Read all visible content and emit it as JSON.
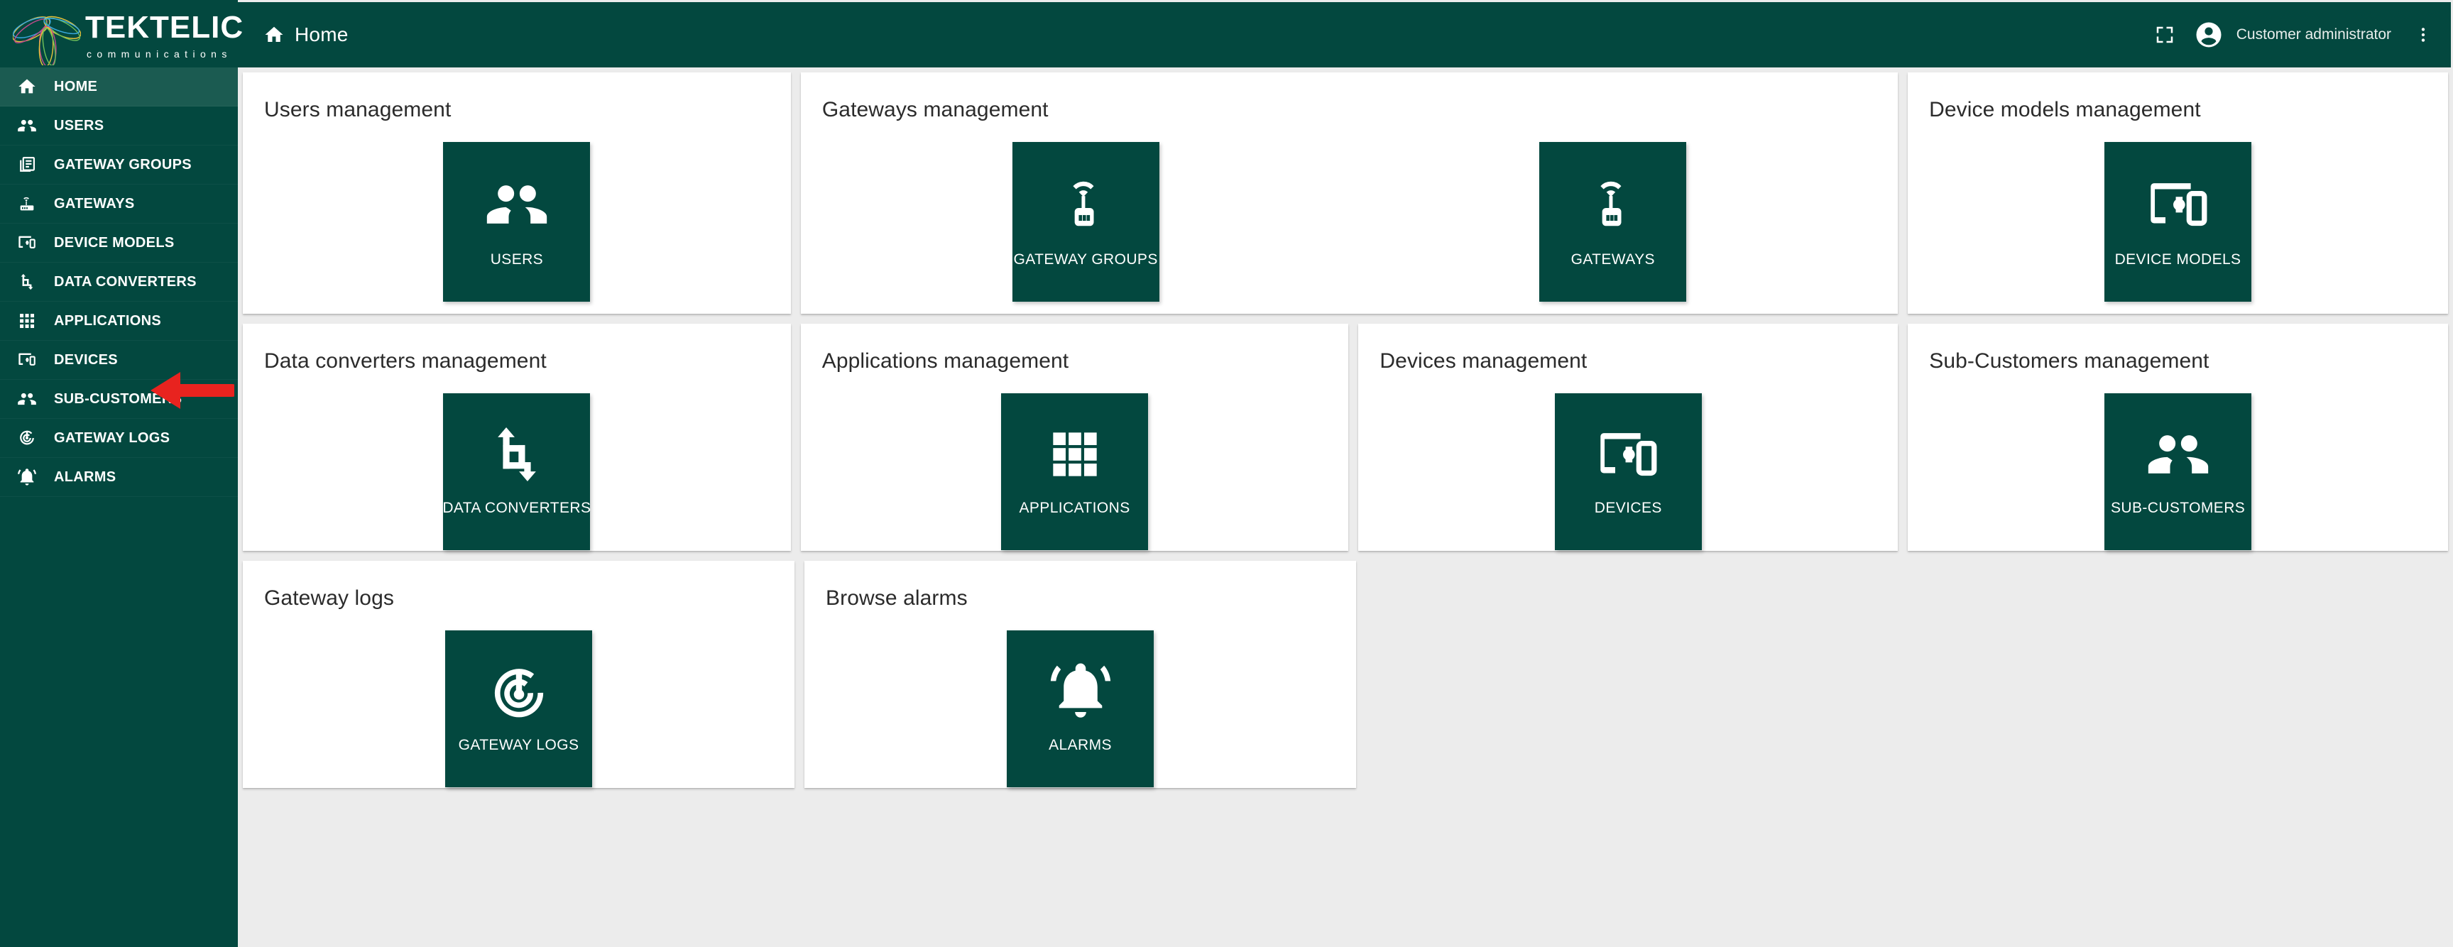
{
  "brand": {
    "name": "TEKTELIC",
    "tagline": "communications",
    "logo_icon": "tektelic-trefoil-logo",
    "primary_color": "#03483f",
    "active_nav_color": "#1b5b51",
    "page_background": "#ececec",
    "annotation_arrow_color": "#e8231f"
  },
  "topbar": {
    "home_icon": "home-icon",
    "title": "Home",
    "fullscreen_icon": "fullscreen-icon",
    "avatar_icon": "account-circle-icon",
    "account_name": "Customer administrator",
    "kebab_icon": "more-vert-icon"
  },
  "sidebar": {
    "items": [
      {
        "label": "HOME",
        "icon": "home-icon",
        "active": true
      },
      {
        "label": "USERS",
        "icon": "people-icon",
        "active": false
      },
      {
        "label": "GATEWAY GROUPS",
        "icon": "library-books-icon",
        "active": false
      },
      {
        "label": "GATEWAYS",
        "icon": "router-icon",
        "active": false
      },
      {
        "label": "DEVICE MODELS",
        "icon": "devices-other-icon",
        "active": false
      },
      {
        "label": "DATA CONVERTERS",
        "icon": "transform-icon",
        "active": false
      },
      {
        "label": "APPLICATIONS",
        "icon": "apps-grid-icon",
        "active": false
      },
      {
        "label": "DEVICES",
        "icon": "devices-other-icon",
        "active": false
      },
      {
        "label": "SUB-CUSTOMERS",
        "icon": "people-icon",
        "active": false
      },
      {
        "label": "GATEWAY LOGS",
        "icon": "track-changes-icon",
        "active": false
      },
      {
        "label": "ALARMS",
        "icon": "notifications-icon",
        "active": false
      }
    ]
  },
  "annotation": {
    "type": "red-left-arrow",
    "points_to": "APPLICATIONS"
  },
  "dashboard": {
    "rows": [
      {
        "cards": [
          {
            "title": "Users management",
            "tiles": [
              {
                "label": "USERS",
                "icon": "people-icon"
              }
            ]
          },
          {
            "title": "Gateways management",
            "tiles": [
              {
                "label": "GATEWAY GROUPS",
                "icon": "router-icon"
              },
              {
                "label": "GATEWAYS",
                "icon": "router-icon"
              }
            ]
          },
          {
            "title": "Device models management",
            "tiles": [
              {
                "label": "DEVICE MODELS",
                "icon": "devices-other-icon"
              }
            ]
          }
        ]
      },
      {
        "cards": [
          {
            "title": "Data converters management",
            "tiles": [
              {
                "label": "DATA CONVERTERS",
                "icon": "transform-icon"
              }
            ]
          },
          {
            "title": "Applications management",
            "tiles": [
              {
                "label": "APPLICATIONS",
                "icon": "apps-grid-icon"
              }
            ]
          },
          {
            "title": "Devices management",
            "tiles": [
              {
                "label": "DEVICES",
                "icon": "devices-other-icon"
              }
            ]
          },
          {
            "title": "Sub-Customers management",
            "tiles": [
              {
                "label": "SUB-CUSTOMERS",
                "icon": "people-icon"
              }
            ]
          }
        ]
      },
      {
        "cards": [
          {
            "title": "Gateway logs",
            "tiles": [
              {
                "label": "GATEWAY LOGS",
                "icon": "track-changes-icon"
              }
            ]
          },
          {
            "title": "Browse alarms",
            "tiles": [
              {
                "label": "ALARMS",
                "icon": "notifications-icon"
              }
            ]
          }
        ]
      }
    ]
  }
}
